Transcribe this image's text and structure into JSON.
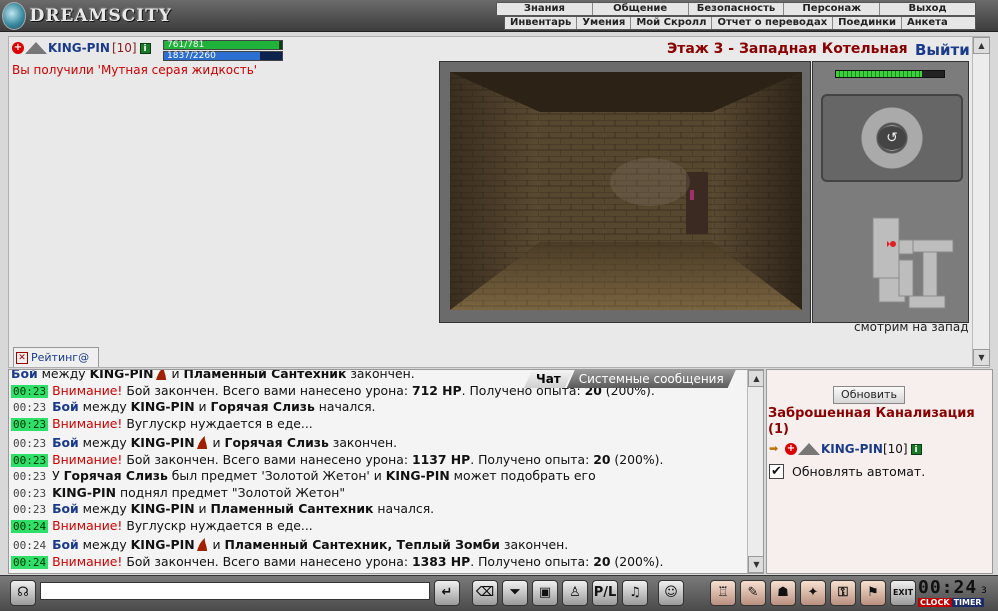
{
  "header": {
    "logo_text": "DREAMSCITY",
    "menu_primary": [
      "Знания",
      "Общение",
      "Безопасность",
      "Персонаж",
      "Выход"
    ],
    "menu_secondary": [
      "Инвентарь",
      "Умения",
      "Мой Скролл",
      "Отчет о переводах",
      "Поединки",
      "Анкета"
    ]
  },
  "player": {
    "name": "KING-PIN",
    "level": "[10]",
    "info_icon": "i",
    "hp": "761/781",
    "hp_fraction": 0.974,
    "mana": "1837/2260",
    "mana_fraction": 0.813
  },
  "notice": "Вы получили 'Мутная серая жидкость'",
  "location_title": "Этаж 3 - Западная Котельная",
  "exit_label": "Выйти",
  "view_direction": "смотрим на запад",
  "rating_tab": "Рейтинг@",
  "chat_tabs": [
    "Чат",
    "Системные сообщения"
  ],
  "chat": {
    "lines": [
      [
        {
          "t": "Бой",
          "c": "b blue"
        },
        {
          "t": " между "
        },
        {
          "t": "KING-PIN",
          "c": "b"
        },
        {
          "flame": 1
        },
        {
          "t": " и "
        },
        {
          "t": "Пламенный Сантехник",
          "c": "b"
        },
        {
          "t": " закончен."
        }
      ],
      [
        {
          "ts": "00:23",
          "g": 1
        },
        {
          "t": " Внимание!",
          "c": "red"
        },
        {
          "t": " Бой закончен. Всего вами нанесено урона: "
        },
        {
          "t": "712 HP",
          "c": "b"
        },
        {
          "t": ". Получено опыта: "
        },
        {
          "t": "20",
          "c": "b"
        },
        {
          "t": " (200%)."
        }
      ],
      [
        {
          "ts": "00:23"
        },
        {
          "t": " "
        },
        {
          "t": "Бой",
          "c": "b blue"
        },
        {
          "t": " между "
        },
        {
          "t": "KING-PIN",
          "c": "b"
        },
        {
          "t": " и "
        },
        {
          "t": "Горячая Слизь",
          "c": "b"
        },
        {
          "t": " начался."
        }
      ],
      [
        {
          "ts": "00:23",
          "g": 1
        },
        {
          "t": " Внимание!",
          "c": "red"
        },
        {
          "t": " Вуглускр нуждается в еде..."
        }
      ],
      [
        {
          "ts": "00:23",
          "gap": 1
        },
        {
          "t": " "
        },
        {
          "t": "Бой",
          "c": "b blue"
        },
        {
          "t": " между "
        },
        {
          "t": "KING-PIN",
          "c": "b"
        },
        {
          "flame": 1
        },
        {
          "t": " и "
        },
        {
          "t": "Горячая Слизь",
          "c": "b"
        },
        {
          "t": " закончен."
        }
      ],
      [
        {
          "ts": "00:23",
          "g": 1
        },
        {
          "t": " Внимание!",
          "c": "red"
        },
        {
          "t": " Бой закончен. Всего вами нанесено урона: "
        },
        {
          "t": "1137 HP",
          "c": "b"
        },
        {
          "t": ". Получено опыта: "
        },
        {
          "t": "20",
          "c": "b"
        },
        {
          "t": " (200%)."
        }
      ],
      [
        {
          "ts": "00:23"
        },
        {
          "t": " У "
        },
        {
          "t": "Горячая Слизь",
          "c": "b"
        },
        {
          "t": " был предмет 'Золотой Жетон' и "
        },
        {
          "t": "KING-PIN",
          "c": "b"
        },
        {
          "t": " может подобрать его"
        }
      ],
      [
        {
          "ts": "00:23"
        },
        {
          "t": " "
        },
        {
          "t": "KING-PIN",
          "c": "b"
        },
        {
          "t": " поднял предмет \"Золотой Жетон\""
        }
      ],
      [
        {
          "ts": "00:23"
        },
        {
          "t": " "
        },
        {
          "t": "Бой",
          "c": "b blue"
        },
        {
          "t": " между "
        },
        {
          "t": "KING-PIN",
          "c": "b"
        },
        {
          "t": " и "
        },
        {
          "t": "Пламенный Сантехник",
          "c": "b"
        },
        {
          "t": " начался."
        }
      ],
      [
        {
          "ts": "00:24",
          "g": 1
        },
        {
          "t": " Внимание!",
          "c": "red"
        },
        {
          "t": " Вуглускр нуждается в еде..."
        }
      ],
      [
        {
          "ts": "00:24",
          "gap": 1
        },
        {
          "t": " "
        },
        {
          "t": "Бой",
          "c": "b blue"
        },
        {
          "t": " между "
        },
        {
          "t": "KING-PIN",
          "c": "b"
        },
        {
          "flame": 1
        },
        {
          "t": " и "
        },
        {
          "t": "Пламенный Сантехник, Теплый Зомби",
          "c": "b"
        },
        {
          "t": " закончен."
        }
      ],
      [
        {
          "ts": "00:24",
          "g": 1
        },
        {
          "t": " Внимание!",
          "c": "red"
        },
        {
          "t": " Бой закончен. Всего вами нанесено урона: "
        },
        {
          "t": "1383 HP",
          "c": "b"
        },
        {
          "t": ". Получено опыта: "
        },
        {
          "t": "20",
          "c": "b"
        },
        {
          "t": " (200%)."
        }
      ]
    ]
  },
  "right_panel": {
    "refresh_label": "Обновить",
    "area_name": "Заброшенная Канализация (1)",
    "player_name": "KING-PIN",
    "player_level": "[10]",
    "auto_refresh_label": "Обновлять автомат.",
    "auto_refresh_checked": true
  },
  "bottom": {
    "input_value": "",
    "exit_label": "EXIT",
    "clock_time": "00:24",
    "clock_seconds": "3",
    "clock_label": "CLOCK",
    "timer_label": "TIMER"
  },
  "colors": {
    "accent_red": "#8b0000",
    "link_blue": "#1a3a8c",
    "hp_green": "#1fb33a",
    "mana_blue": "#2d6fd1",
    "timestamp_green": "#2ee06a"
  }
}
